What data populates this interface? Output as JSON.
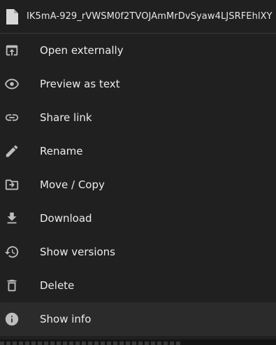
{
  "file": {
    "name": "IK5mA-929_rVWSM0f2TVOJAmMrDvSyaw4LJSRFEhlXY",
    "icon": "file-icon"
  },
  "menu": {
    "items": [
      {
        "label": "Open externally",
        "icon": "open-external-icon"
      },
      {
        "label": "Preview as text",
        "icon": "eye-icon"
      },
      {
        "label": "Share link",
        "icon": "link-icon"
      },
      {
        "label": "Rename",
        "icon": "pencil-icon"
      },
      {
        "label": "Move / Copy",
        "icon": "folder-move-icon"
      },
      {
        "label": "Download",
        "icon": "download-icon"
      },
      {
        "label": "Show versions",
        "icon": "history-icon"
      },
      {
        "label": "Delete",
        "icon": "trash-icon"
      },
      {
        "label": "Show info",
        "icon": "info-icon"
      }
    ],
    "highlighted_item": "Show info"
  },
  "colors": {
    "background": "#202020",
    "highlight": "#2b2b2b",
    "icon": "#bdbdbd",
    "text": "#ececec"
  }
}
